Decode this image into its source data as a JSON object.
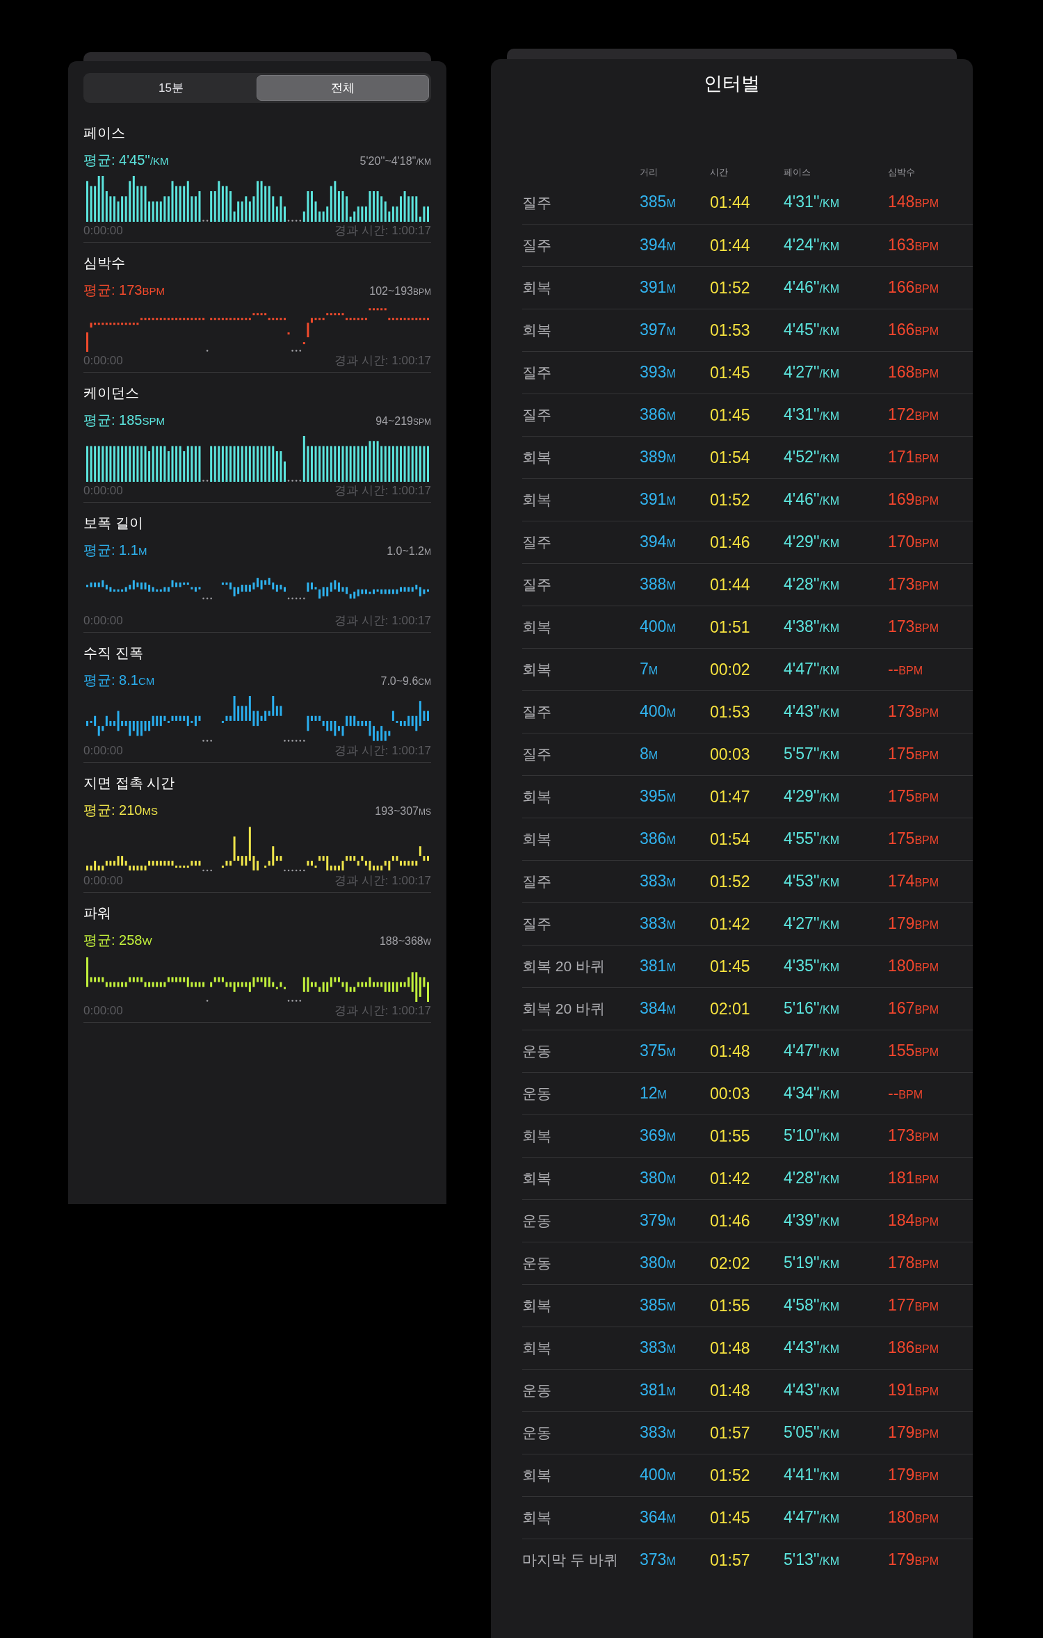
{
  "segments": [
    {
      "label": "15분",
      "selected": false
    },
    {
      "label": "전체",
      "selected": true
    }
  ],
  "metrics": [
    {
      "title": "페이스",
      "average": "평균: 4'45''",
      "average_unit": "/KM",
      "range": "5'20''~4'18''",
      "range_unit": "/KM",
      "color": "#5ce5de",
      "kind": "bar",
      "start_time": "0:00:00",
      "elapsed_time": "경과 시간: 1:00:17"
    },
    {
      "title": "심박수",
      "average": "평균: 173",
      "average_unit": "BPM",
      "range": "102~193",
      "range_unit": "BPM",
      "color": "#f04a2c",
      "kind": "range",
      "start_time": "0:00:00",
      "elapsed_time": "경과 시간: 1:00:17"
    },
    {
      "title": "케이던스",
      "average": "평균: 185",
      "average_unit": "SPM",
      "range": "94~219",
      "range_unit": "SPM",
      "color": "#5ce5de",
      "kind": "bar",
      "start_time": "0:00:00",
      "elapsed_time": "경과 시간: 1:00:17"
    },
    {
      "title": "보폭 길이",
      "average": "평균: 1.1",
      "average_unit": "M",
      "range": "1.0~1.2",
      "range_unit": "M",
      "color": "#2eb2ee",
      "kind": "range",
      "start_time": "0:00:00",
      "elapsed_time": "경과 시간: 1:00:17"
    },
    {
      "title": "수직 진폭",
      "average": "평균: 8.1",
      "average_unit": "CM",
      "range": "7.0~9.6",
      "range_unit": "CM",
      "color": "#2aaeee",
      "kind": "range",
      "start_time": "0:00:00",
      "elapsed_time": "경과 시간: 1:00:17"
    },
    {
      "title": "지면 접촉 시간",
      "average": "평균: 210",
      "average_unit": "MS",
      "range": "193~307",
      "range_unit": "MS",
      "color": "#efe54b",
      "kind": "range",
      "start_time": "0:00:00",
      "elapsed_time": "경과 시간: 1:00:17"
    },
    {
      "title": "파워",
      "average": "평균: 258",
      "average_unit": "W",
      "range": "188~368",
      "range_unit": "W",
      "color": "#c2f03c",
      "kind": "range",
      "start_time": "0:00:00",
      "elapsed_time": "경과 시간: 1:00:17"
    }
  ],
  "intervals": {
    "title": "인터벌",
    "columns": [
      "거리",
      "시간",
      "페이스",
      "심박수"
    ],
    "rows": [
      {
        "name": "질주",
        "distance": [
          "385",
          "M"
        ],
        "time": "01:44",
        "pace": [
          "4'31''",
          "/KM"
        ],
        "heart_rate": [
          "148",
          "BPM"
        ]
      },
      {
        "name": "질주",
        "distance": [
          "394",
          "M"
        ],
        "time": "01:44",
        "pace": [
          "4'24''",
          "/KM"
        ],
        "heart_rate": [
          "163",
          "BPM"
        ]
      },
      {
        "name": "회복",
        "distance": [
          "391",
          "M"
        ],
        "time": "01:52",
        "pace": [
          "4'46''",
          "/KM"
        ],
        "heart_rate": [
          "166",
          "BPM"
        ]
      },
      {
        "name": "회복",
        "distance": [
          "397",
          "M"
        ],
        "time": "01:53",
        "pace": [
          "4'45''",
          "/KM"
        ],
        "heart_rate": [
          "166",
          "BPM"
        ]
      },
      {
        "name": "질주",
        "distance": [
          "393",
          "M"
        ],
        "time": "01:45",
        "pace": [
          "4'27''",
          "/KM"
        ],
        "heart_rate": [
          "168",
          "BPM"
        ]
      },
      {
        "name": "질주",
        "distance": [
          "386",
          "M"
        ],
        "time": "01:45",
        "pace": [
          "4'31''",
          "/KM"
        ],
        "heart_rate": [
          "172",
          "BPM"
        ]
      },
      {
        "name": "회복",
        "distance": [
          "389",
          "M"
        ],
        "time": "01:54",
        "pace": [
          "4'52''",
          "/KM"
        ],
        "heart_rate": [
          "171",
          "BPM"
        ]
      },
      {
        "name": "회복",
        "distance": [
          "391",
          "M"
        ],
        "time": "01:52",
        "pace": [
          "4'46''",
          "/KM"
        ],
        "heart_rate": [
          "169",
          "BPM"
        ]
      },
      {
        "name": "질주",
        "distance": [
          "394",
          "M"
        ],
        "time": "01:46",
        "pace": [
          "4'29''",
          "/KM"
        ],
        "heart_rate": [
          "170",
          "BPM"
        ]
      },
      {
        "name": "질주",
        "distance": [
          "388",
          "M"
        ],
        "time": "01:44",
        "pace": [
          "4'28''",
          "/KM"
        ],
        "heart_rate": [
          "173",
          "BPM"
        ]
      },
      {
        "name": "회복",
        "distance": [
          "400",
          "M"
        ],
        "time": "01:51",
        "pace": [
          "4'38''",
          "/KM"
        ],
        "heart_rate": [
          "173",
          "BPM"
        ]
      },
      {
        "name": "회복",
        "distance": [
          "7",
          "M"
        ],
        "time": "00:02",
        "pace": [
          "4'47''",
          "/KM"
        ],
        "heart_rate": [
          "--",
          "BPM"
        ]
      },
      {
        "name": "질주",
        "distance": [
          "400",
          "M"
        ],
        "time": "01:53",
        "pace": [
          "4'43''",
          "/KM"
        ],
        "heart_rate": [
          "173",
          "BPM"
        ]
      },
      {
        "name": "질주",
        "distance": [
          "8",
          "M"
        ],
        "time": "00:03",
        "pace": [
          "5'57''",
          "/KM"
        ],
        "heart_rate": [
          "175",
          "BPM"
        ]
      },
      {
        "name": "회복",
        "distance": [
          "395",
          "M"
        ],
        "time": "01:47",
        "pace": [
          "4'29''",
          "/KM"
        ],
        "heart_rate": [
          "175",
          "BPM"
        ]
      },
      {
        "name": "회복",
        "distance": [
          "386",
          "M"
        ],
        "time": "01:54",
        "pace": [
          "4'55''",
          "/KM"
        ],
        "heart_rate": [
          "175",
          "BPM"
        ]
      },
      {
        "name": "질주",
        "distance": [
          "383",
          "M"
        ],
        "time": "01:52",
        "pace": [
          "4'53''",
          "/KM"
        ],
        "heart_rate": [
          "174",
          "BPM"
        ]
      },
      {
        "name": "질주",
        "distance": [
          "383",
          "M"
        ],
        "time": "01:42",
        "pace": [
          "4'27''",
          "/KM"
        ],
        "heart_rate": [
          "179",
          "BPM"
        ]
      },
      {
        "name": "회복 20 바퀴",
        "distance": [
          "381",
          "M"
        ],
        "time": "01:45",
        "pace": [
          "4'35''",
          "/KM"
        ],
        "heart_rate": [
          "180",
          "BPM"
        ]
      },
      {
        "name": "회복 20 바퀴",
        "distance": [
          "384",
          "M"
        ],
        "time": "02:01",
        "pace": [
          "5'16''",
          "/KM"
        ],
        "heart_rate": [
          "167",
          "BPM"
        ]
      },
      {
        "name": "운동",
        "distance": [
          "375",
          "M"
        ],
        "time": "01:48",
        "pace": [
          "4'47''",
          "/KM"
        ],
        "heart_rate": [
          "155",
          "BPM"
        ]
      },
      {
        "name": "운동",
        "distance": [
          "12",
          "M"
        ],
        "time": "00:03",
        "pace": [
          "4'34''",
          "/KM"
        ],
        "heart_rate": [
          "--",
          "BPM"
        ]
      },
      {
        "name": "회복",
        "distance": [
          "369",
          "M"
        ],
        "time": "01:55",
        "pace": [
          "5'10''",
          "/KM"
        ],
        "heart_rate": [
          "173",
          "BPM"
        ]
      },
      {
        "name": "회복",
        "distance": [
          "380",
          "M"
        ],
        "time": "01:42",
        "pace": [
          "4'28''",
          "/KM"
        ],
        "heart_rate": [
          "181",
          "BPM"
        ]
      },
      {
        "name": "운동",
        "distance": [
          "379",
          "M"
        ],
        "time": "01:46",
        "pace": [
          "4'39''",
          "/KM"
        ],
        "heart_rate": [
          "184",
          "BPM"
        ]
      },
      {
        "name": "운동",
        "distance": [
          "380",
          "M"
        ],
        "time": "02:02",
        "pace": [
          "5'19''",
          "/KM"
        ],
        "heart_rate": [
          "178",
          "BPM"
        ]
      },
      {
        "name": "회복",
        "distance": [
          "385",
          "M"
        ],
        "time": "01:55",
        "pace": [
          "4'58''",
          "/KM"
        ],
        "heart_rate": [
          "177",
          "BPM"
        ]
      },
      {
        "name": "회복",
        "distance": [
          "383",
          "M"
        ],
        "time": "01:48",
        "pace": [
          "4'43''",
          "/KM"
        ],
        "heart_rate": [
          "186",
          "BPM"
        ]
      },
      {
        "name": "운동",
        "distance": [
          "381",
          "M"
        ],
        "time": "01:48",
        "pace": [
          "4'43''",
          "/KM"
        ],
        "heart_rate": [
          "191",
          "BPM"
        ]
      },
      {
        "name": "운동",
        "distance": [
          "383",
          "M"
        ],
        "time": "01:57",
        "pace": [
          "5'05''",
          "/KM"
        ],
        "heart_rate": [
          "179",
          "BPM"
        ]
      },
      {
        "name": "회복",
        "distance": [
          "400",
          "M"
        ],
        "time": "01:52",
        "pace": [
          "4'41''",
          "/KM"
        ],
        "heart_rate": [
          "179",
          "BPM"
        ]
      },
      {
        "name": "회복",
        "distance": [
          "364",
          "M"
        ],
        "time": "01:45",
        "pace": [
          "4'47''",
          "/KM"
        ],
        "heart_rate": [
          "180",
          "BPM"
        ]
      },
      {
        "name": "마지막 두 바퀴",
        "distance": [
          "373",
          "M"
        ],
        "time": "01:57",
        "pace": [
          "5'13''",
          "/KM"
        ],
        "heart_rate": [
          "179",
          "BPM"
        ]
      }
    ]
  }
}
